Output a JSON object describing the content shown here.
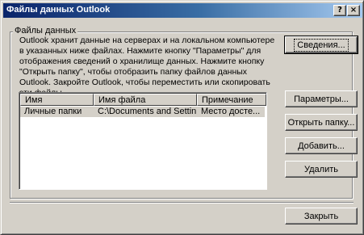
{
  "window": {
    "title": "Файлы данных Outlook",
    "help_glyph": "?",
    "close_glyph": "×"
  },
  "group": {
    "label": "Файлы данных",
    "description": "Outlook хранит данные на серверах и на локальном компьютере в указанных ниже файлах. Нажмите кнопку \"Параметры\" для отображения сведений о хранилище данных. Нажмите кнопку \"Открыть папку\", чтобы отобразить папку файлов данных Outlook. Закройте Outlook, чтобы переместить или скопировать эти файлы."
  },
  "list": {
    "columns": [
      "Имя",
      "Имя файла",
      "Примечание"
    ],
    "rows": [
      [
        "Личные папки",
        "C:\\Documents and Settin...",
        "Место досте..."
      ]
    ]
  },
  "buttons": {
    "details": "Сведения...",
    "settings": "Параметры...",
    "open_folder": "Открыть папку...",
    "add": "Добавить...",
    "remove": "Удалить",
    "close": "Закрыть"
  }
}
